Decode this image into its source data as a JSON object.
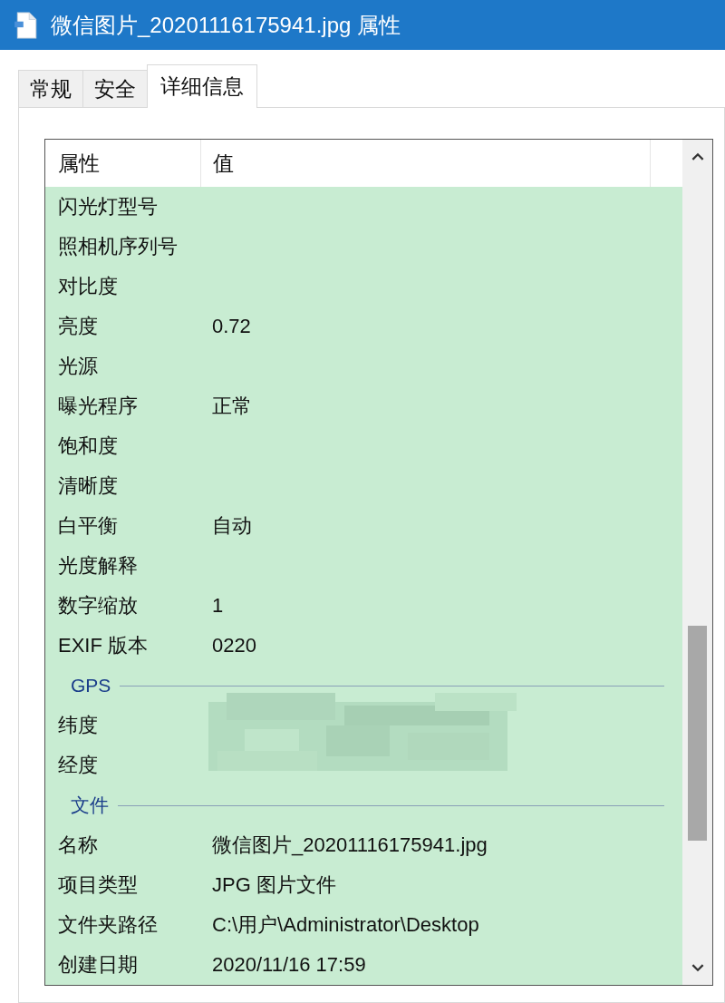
{
  "window": {
    "title": "微信图片_20201116175941.jpg 属性"
  },
  "tabs": [
    {
      "label": "常规",
      "selected": false
    },
    {
      "label": "安全",
      "selected": false
    },
    {
      "label": "详细信息",
      "selected": true
    }
  ],
  "table": {
    "columns": [
      "属性",
      "值"
    ],
    "rows": [
      {
        "kind": "row",
        "property": "闪光灯型号"
      },
      {
        "kind": "row",
        "property": "照相机序列号"
      },
      {
        "kind": "row",
        "property": "对比度"
      },
      {
        "kind": "row",
        "property": "亮度",
        "value": "0.72"
      },
      {
        "kind": "row",
        "property": "光源"
      },
      {
        "kind": "row",
        "property": "曝光程序",
        "value": "正常"
      },
      {
        "kind": "row",
        "property": "饱和度"
      },
      {
        "kind": "row",
        "property": "清晰度"
      },
      {
        "kind": "row",
        "property": "白平衡",
        "value": "自动"
      },
      {
        "kind": "row",
        "property": "光度解释"
      },
      {
        "kind": "row",
        "property": "数字缩放",
        "value": "1"
      },
      {
        "kind": "row",
        "property": "EXIF 版本",
        "value": "0220"
      },
      {
        "kind": "group",
        "label": "GPS"
      },
      {
        "kind": "redacted",
        "property": "纬度"
      },
      {
        "kind": "redacted",
        "property": "经度"
      },
      {
        "kind": "group",
        "label": "文件"
      },
      {
        "kind": "row",
        "property": "名称",
        "value": "微信图片_20201116175941.jpg"
      },
      {
        "kind": "row",
        "property": "项目类型",
        "value": "JPG 图片文件"
      },
      {
        "kind": "row",
        "property": "文件夹路径",
        "value": "C:\\用户\\Administrator\\Desktop"
      },
      {
        "kind": "row",
        "property": "创建日期",
        "value": "2020/11/16 17:59"
      }
    ]
  }
}
